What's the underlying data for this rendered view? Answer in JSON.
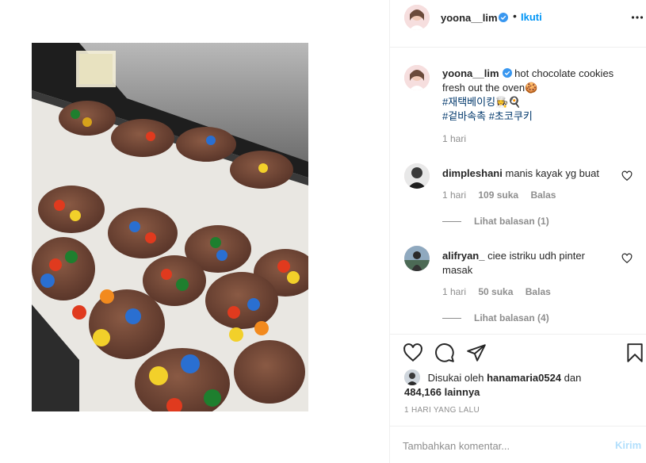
{
  "post": {
    "image_alt": "hot chocolate cookies with colorful candies on a baking tray in an oven"
  },
  "header": {
    "username": "yoona__lim",
    "dot": "•",
    "follow_label": "Ikuti",
    "verified_icon": "verified-badge-icon",
    "more_icon": "more-options-icon"
  },
  "caption": {
    "username": "yoona__lim",
    "text": "hot chocolate cookies fresh out the oven🍪",
    "hashtag_line_1": "#재택베이킹",
    "hashtag_line_1_emoji": "👩‍🍳🍳",
    "hashtag_line_2a": "#겉바속촉",
    "hashtag_line_2b": "#초코쿠키",
    "time": "1 hari"
  },
  "comments": [
    {
      "username": "dimpleshani",
      "text": "manis kayak yg buat",
      "time": "1 hari",
      "likes": "109 suka",
      "reply_label": "Balas",
      "view_replies": "Lihat balasan (1)"
    },
    {
      "username": "alifryan_",
      "text": "ciee istriku udh pinter masak",
      "time": "1 hari",
      "likes": "50 suka",
      "reply_label": "Balas",
      "view_replies": "Lihat balasan (4)"
    }
  ],
  "likes": {
    "prefix": "Disukai oleh",
    "liker": "hanamaria0524",
    "conjunction": "dan",
    "count": "484,166 lainnya"
  },
  "post_date": "1 HARI YANG LALU",
  "comment_box": {
    "placeholder": "Tambahkan komentar...",
    "post_label": "Kirim"
  },
  "colors": {
    "accent": "#0095f6",
    "post_button_disabled": "#b2dffc",
    "hashtag": "#00376b",
    "muted": "#8e8e8e",
    "text": "#262626"
  }
}
